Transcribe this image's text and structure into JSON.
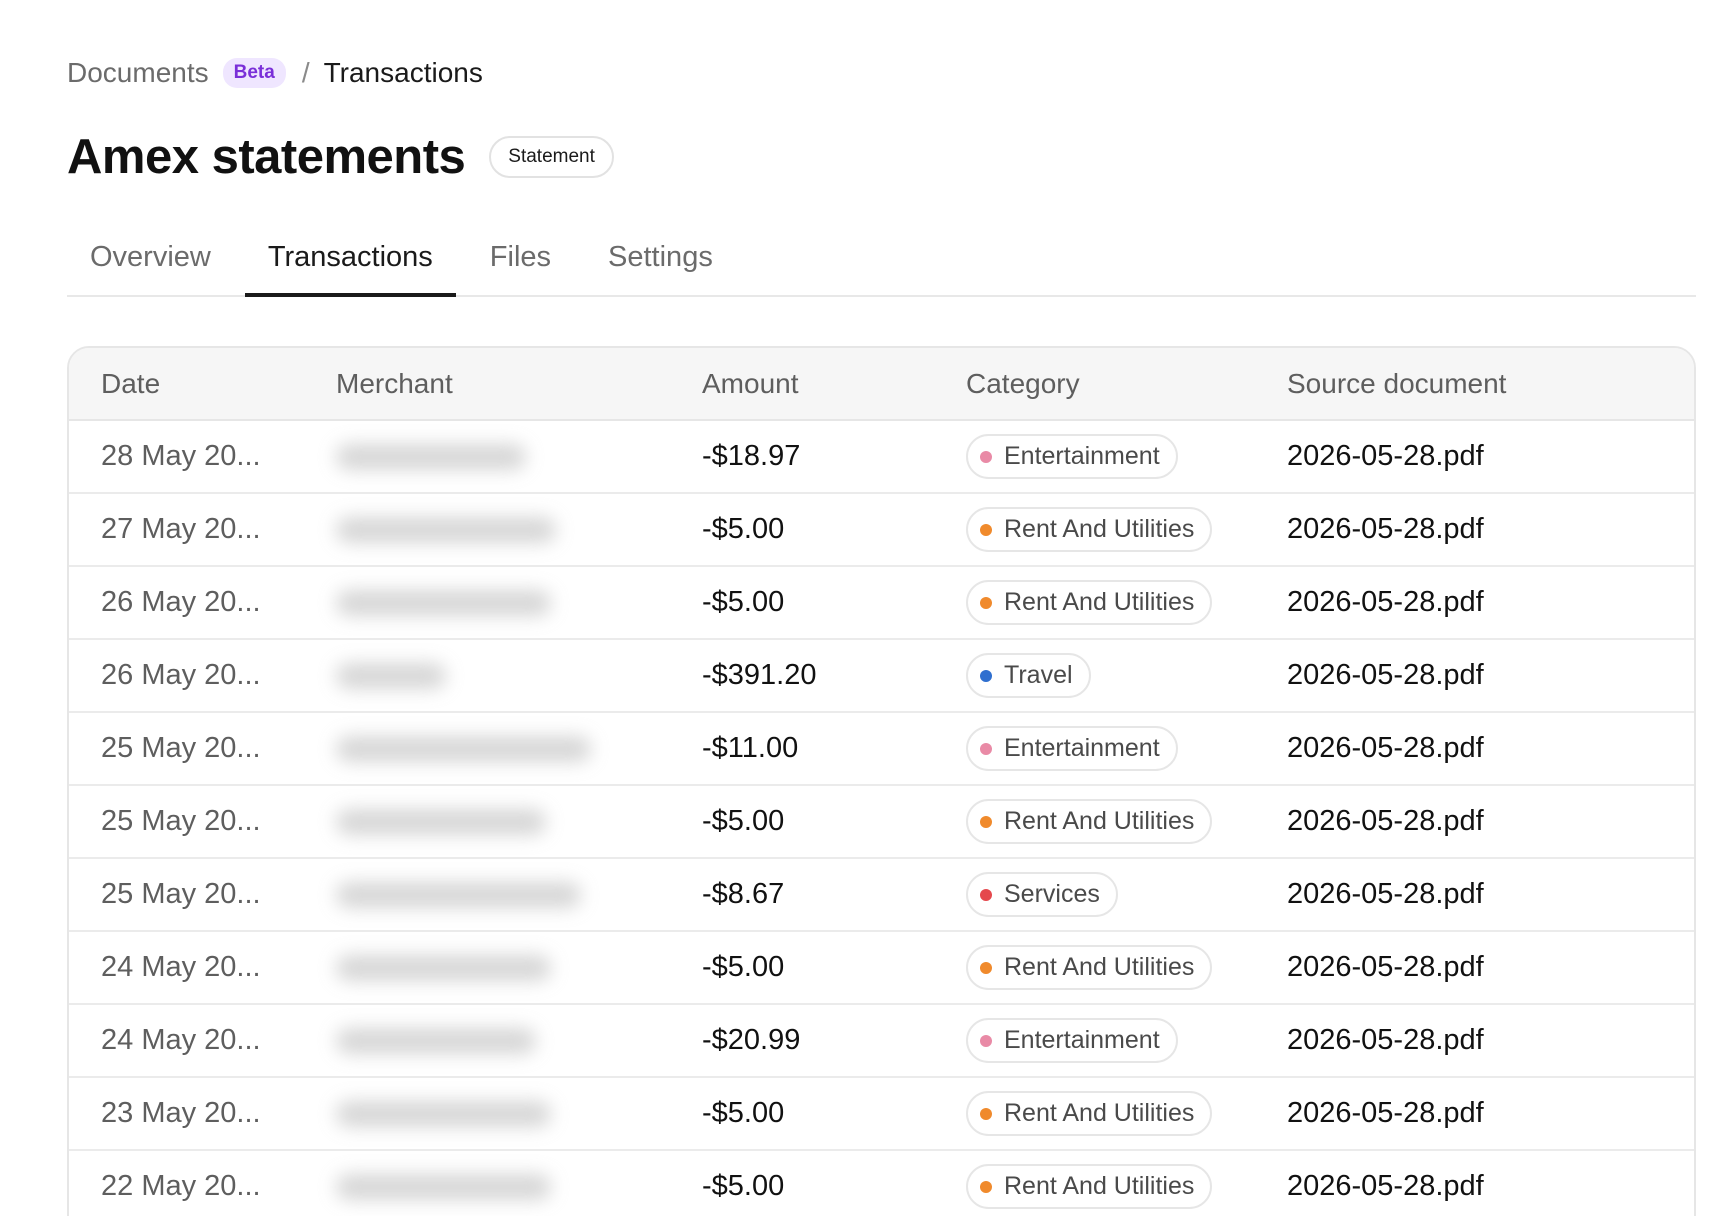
{
  "breadcrumb": {
    "root": "Documents",
    "badge": "Beta",
    "separator": "/",
    "current": "Transactions"
  },
  "page": {
    "title": "Amex statements",
    "type_badge": "Statement"
  },
  "tabs": [
    {
      "label": "Overview",
      "active": false
    },
    {
      "label": "Transactions",
      "active": true
    },
    {
      "label": "Files",
      "active": false
    },
    {
      "label": "Settings",
      "active": false
    }
  ],
  "table": {
    "columns": [
      "Date",
      "Merchant",
      "Amount",
      "Category",
      "Source document"
    ],
    "rows": [
      {
        "date": "28 May 20...",
        "amount": "-$18.97",
        "category": "Entertainment",
        "source": "2026-05-28.pdf"
      },
      {
        "date": "27 May 20...",
        "amount": "-$5.00",
        "category": "Rent And Utilities",
        "source": "2026-05-28.pdf"
      },
      {
        "date": "26 May 20...",
        "amount": "-$5.00",
        "category": "Rent And Utilities",
        "source": "2026-05-28.pdf"
      },
      {
        "date": "26 May 20...",
        "amount": "-$391.20",
        "category": "Travel",
        "source": "2026-05-28.pdf"
      },
      {
        "date": "25 May 20...",
        "amount": "-$11.00",
        "category": "Entertainment",
        "source": "2026-05-28.pdf"
      },
      {
        "date": "25 May 20...",
        "amount": "-$5.00",
        "category": "Rent And Utilities",
        "source": "2026-05-28.pdf"
      },
      {
        "date": "25 May 20...",
        "amount": "-$8.67",
        "category": "Services",
        "source": "2026-05-28.pdf"
      },
      {
        "date": "24 May 20...",
        "amount": "-$5.00",
        "category": "Rent And Utilities",
        "source": "2026-05-28.pdf"
      },
      {
        "date": "24 May 20...",
        "amount": "-$20.99",
        "category": "Entertainment",
        "source": "2026-05-28.pdf"
      },
      {
        "date": "23 May 20...",
        "amount": "-$5.00",
        "category": "Rent And Utilities",
        "source": "2026-05-28.pdf"
      },
      {
        "date": "22 May 20...",
        "amount": "-$5.00",
        "category": "Rent And Utilities",
        "source": "2026-05-28.pdf"
      }
    ]
  },
  "category_colors": {
    "Entertainment": "#e98aa6",
    "Rent And Utilities": "#f08a2c",
    "Travel": "#2f6fcf",
    "Services": "#e5484d"
  }
}
